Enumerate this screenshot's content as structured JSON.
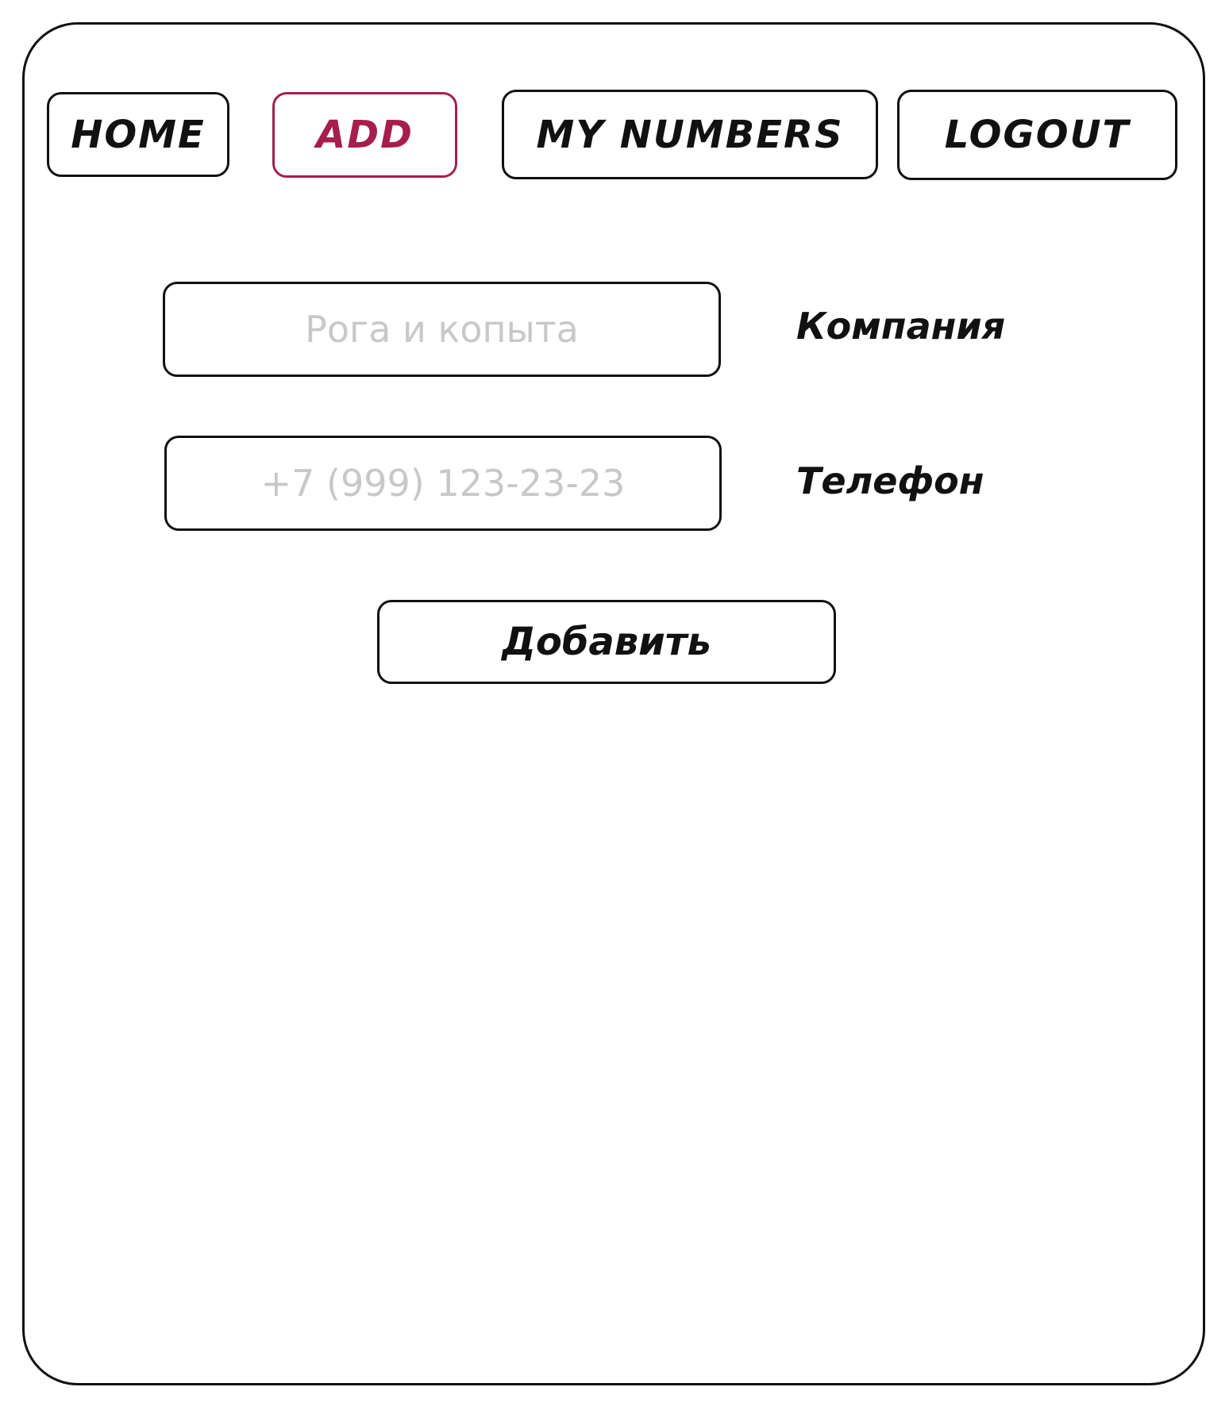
{
  "nav": {
    "items": [
      {
        "label": "HOME",
        "active": false
      },
      {
        "label": "ADD",
        "active": true
      },
      {
        "label": "MY NUMBERS",
        "active": false
      },
      {
        "label": "LOGOUT",
        "active": false
      }
    ],
    "active_color": "#a61e4d"
  },
  "form": {
    "company": {
      "label": "Компания",
      "placeholder": "Рога и копыта",
      "value": ""
    },
    "phone": {
      "label": "Телефон",
      "placeholder": "+7 (999) 123-23-23",
      "value": ""
    },
    "submit_label": "Добавить"
  }
}
